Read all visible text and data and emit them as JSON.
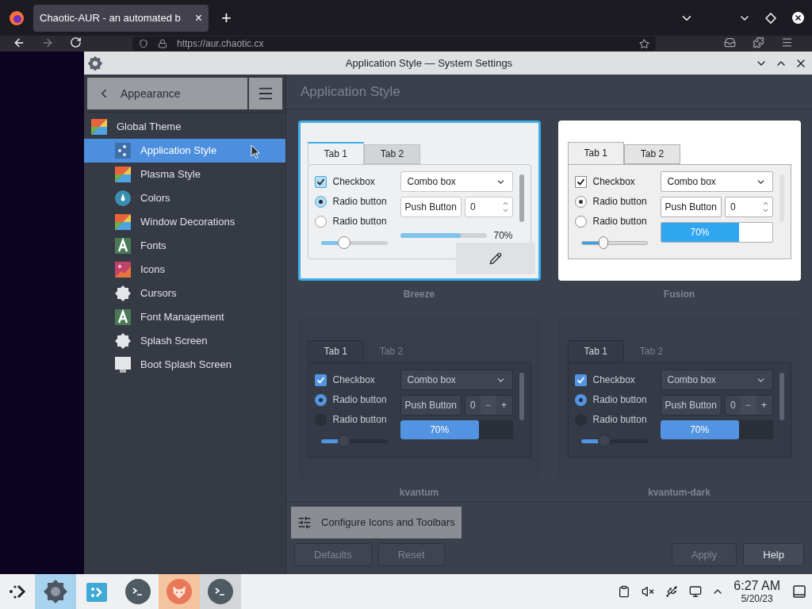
{
  "browser": {
    "tab_title": "Chaotic-AUR - an automated b",
    "tab_close": "×",
    "new_tab": "+",
    "url": "https://aur.chaotic.cx"
  },
  "window": {
    "title": "Application Style — System Settings"
  },
  "sidebar": {
    "back_label": "Appearance",
    "items": [
      {
        "label": "Global Theme",
        "selected": false,
        "children": [
          {
            "label": "Application Style",
            "selected": true
          },
          {
            "label": "Plasma Style",
            "selected": false
          },
          {
            "label": "Colors",
            "selected": false
          },
          {
            "label": "Window Decorations",
            "selected": false
          },
          {
            "label": "Fonts",
            "selected": false
          },
          {
            "label": "Icons",
            "selected": false
          },
          {
            "label": "Cursors",
            "selected": false
          },
          {
            "label": "Font Management",
            "selected": false
          },
          {
            "label": "Splash Screen",
            "selected": false
          },
          {
            "label": "Boot Splash Screen",
            "selected": false
          }
        ]
      }
    ]
  },
  "page": {
    "heading": "Application Style",
    "styles": [
      {
        "name": "Breeze",
        "kind": "breeze",
        "selected": true,
        "edit_button": true,
        "preview": {
          "tabs": [
            {
              "label": "Tab 1",
              "selected": true
            },
            {
              "label": "Tab 2",
              "selected": false
            }
          ],
          "checkbox": {
            "label": "Checkbox",
            "checked": true
          },
          "radios": [
            {
              "label": "Radio button",
              "selected": true
            },
            {
              "label": "Radio button",
              "selected": false
            }
          ],
          "combo": "Combo box",
          "push": "Push Button",
          "spin": "0",
          "slider": {
            "level": 0.35
          },
          "progress": {
            "level": 0.7,
            "text": "70%"
          }
        }
      },
      {
        "name": "Fusion",
        "kind": "fusion",
        "selected": false,
        "edit_button": false,
        "preview": {
          "tabs": [
            {
              "label": "Tab 1",
              "selected": true
            },
            {
              "label": "Tab 2",
              "selected": false
            }
          ],
          "checkbox": {
            "label": "Checkbox",
            "checked": true
          },
          "radios": [
            {
              "label": "Radio button",
              "selected": true
            },
            {
              "label": "Radio button",
              "selected": false
            }
          ],
          "combo": "Combo box",
          "push": "Push Button",
          "spin": "0",
          "slider": {
            "level": 0.33
          },
          "progress": {
            "level": 0.7,
            "text": "70%"
          }
        }
      },
      {
        "name": "kvantum",
        "kind": "kvantum",
        "selected": false,
        "edit_button": false,
        "preview": {
          "tabs": [
            {
              "label": "Tab 1",
              "selected": true
            },
            {
              "label": "Tab 2",
              "selected": false
            }
          ],
          "checkbox": {
            "label": "Checkbox",
            "checked": true
          },
          "radios": [
            {
              "label": "Radio button",
              "selected": true
            },
            {
              "label": "Radio button",
              "selected": false
            }
          ],
          "combo": "Combo box",
          "push": "Push Button",
          "spin": "0",
          "spin_minus": "−",
          "spin_plus": "+",
          "slider": {
            "level": 0.35
          },
          "progress": {
            "level": 0.7,
            "text": "70%"
          }
        }
      },
      {
        "name": "kvantum-dark",
        "kind": "kvantum",
        "selected": false,
        "edit_button": false,
        "preview": {
          "tabs": [
            {
              "label": "Tab 1",
              "selected": true
            },
            {
              "label": "Tab 2",
              "selected": false
            }
          ],
          "checkbox": {
            "label": "Checkbox",
            "checked": true
          },
          "radios": [
            {
              "label": "Radio button",
              "selected": true
            },
            {
              "label": "Radio button",
              "selected": false
            }
          ],
          "combo": "Combo box",
          "push": "Push Button",
          "spin": "0",
          "spin_minus": "−",
          "spin_plus": "+",
          "slider": {
            "level": 0.35
          },
          "progress": {
            "level": 0.7,
            "text": "70%"
          }
        }
      }
    ]
  },
  "footer": {
    "configure_button": "Configure Icons and Toolbars",
    "buttons": [
      {
        "label": "Defaults",
        "disabled": true
      },
      {
        "label": "Reset",
        "disabled": true
      },
      {
        "label": "Apply",
        "disabled": true
      },
      {
        "label": "Help",
        "disabled": false
      }
    ]
  },
  "taskbar": {
    "tasks": [
      {
        "kind": "settings",
        "color": "#a7d3ee"
      },
      {
        "kind": "discover"
      },
      {
        "kind": "terminal"
      },
      {
        "kind": "firefox",
        "color": "#f3c49d"
      },
      {
        "kind": "terminal",
        "color": "#d3d5d8"
      }
    ],
    "time": "6:27 AM",
    "date": "5/20/23"
  }
}
